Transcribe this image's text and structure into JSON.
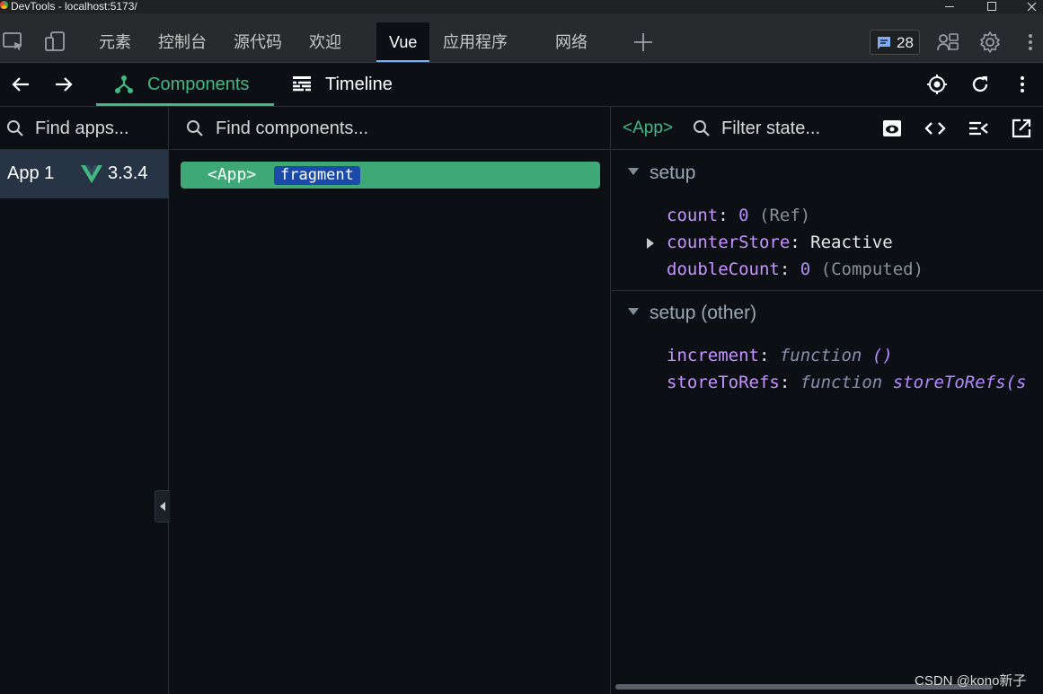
{
  "window": {
    "title": "DevTools - localhost:5173/"
  },
  "devtools_tabs": [
    {
      "label": "元素"
    },
    {
      "label": "控制台"
    },
    {
      "label": "源代码"
    },
    {
      "label": "欢迎"
    },
    {
      "label": "Vue"
    },
    {
      "label": "应用程序"
    },
    {
      "label": "网络"
    }
  ],
  "issues_badge": {
    "count": "28"
  },
  "vue_tabs": {
    "components": "Components",
    "timeline": "Timeline"
  },
  "apps_pane": {
    "search_placeholder": "Find apps...",
    "app": {
      "name": "App 1",
      "version": "3.3.4"
    }
  },
  "tree_pane": {
    "search_placeholder": "Find components...",
    "node": {
      "tag": "<App>",
      "badge": "fragment"
    }
  },
  "state_pane": {
    "component": "<App>",
    "filter_placeholder": "Filter state...",
    "sections": [
      {
        "title": "setup",
        "props": [
          {
            "key": "count",
            "value": "0",
            "meta": "(Ref)"
          },
          {
            "key": "counterStore",
            "value": "Reactive"
          },
          {
            "key": "doubleCount",
            "value": "0",
            "meta": "(Computed)"
          }
        ]
      },
      {
        "title": "setup (other)",
        "props": [
          {
            "key": "increment",
            "fn_kw": "function",
            "fn_sig": "()"
          },
          {
            "key": "storeToRefs",
            "fn_kw": "function",
            "fn_sig": "storeToRefs(s"
          }
        ]
      }
    ]
  },
  "watermark": "CSDN @kono新子",
  "colors": {
    "vue_green": "#42b883",
    "selected_row": "#263445",
    "tree_node": "#3fa877",
    "badge_blue": "#1b4aa8"
  }
}
